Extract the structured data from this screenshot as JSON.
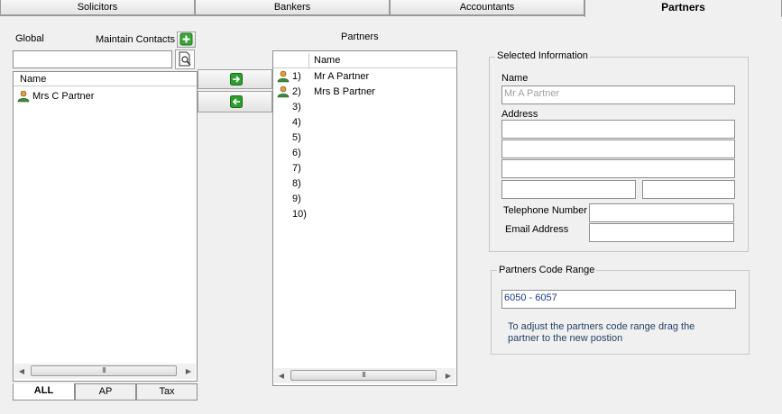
{
  "tabs": [
    "Solicitors",
    "Bankers",
    "Accountants",
    "Partners"
  ],
  "left_panel": {
    "global_label": "Global",
    "maintain_contacts_label": "Maintain Contacts",
    "search_value": "",
    "column_header": "Name",
    "rows": [
      "Mrs C Partner"
    ],
    "bottom_tabs": [
      "ALL",
      "AP",
      "Tax"
    ],
    "scroll_glyph": "III"
  },
  "partners_panel": {
    "title": "Partners",
    "column_header": "Name",
    "rows": [
      {
        "num": "1)",
        "name": "Mr A Partner"
      },
      {
        "num": "2)",
        "name": "Mrs B Partner"
      },
      {
        "num": "3)",
        "name": ""
      },
      {
        "num": "4)",
        "name": ""
      },
      {
        "num": "5)",
        "name": ""
      },
      {
        "num": "6)",
        "name": ""
      },
      {
        "num": "7)",
        "name": ""
      },
      {
        "num": "8)",
        "name": ""
      },
      {
        "num": "9)",
        "name": ""
      },
      {
        "num": "10)",
        "name": ""
      }
    ],
    "scroll_glyph": "III"
  },
  "selected_info": {
    "legend": "Selected Information",
    "name_label": "Name",
    "name_value": "Mr A Partner",
    "address_label": "Address",
    "address_lines": [
      "",
      "",
      "",
      "",
      ""
    ],
    "telephone_label": "Telephone Number",
    "telephone_value": "",
    "email_label": "Email Address",
    "email_value": ""
  },
  "code_range": {
    "legend": "Partners Code Range",
    "value": "6050 - 6057",
    "hint_line1": "To adjust the partners code range drag the",
    "hint_line2": "partner to the new postion"
  },
  "colors": {
    "add_green": "#3aa53a",
    "arrow_green": "#2e9e2e",
    "hint_text": "#1f3f5f",
    "code_text": "#1c3a8a",
    "disabled_text": "#a0a0a0"
  },
  "icons": {
    "add": "plus-icon",
    "lookup": "search-document-icon",
    "move_right": "arrow-right-icon",
    "move_left": "arrow-left-icon",
    "person": "person-icon"
  }
}
